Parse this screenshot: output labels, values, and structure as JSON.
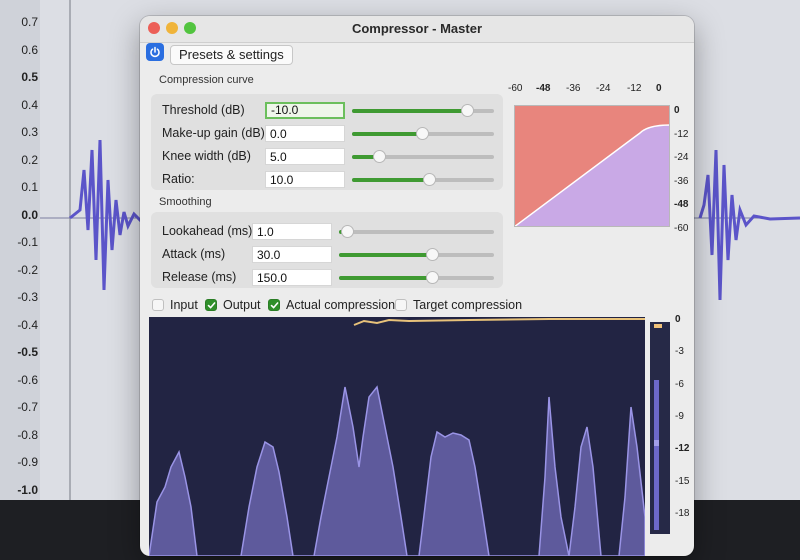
{
  "background": {
    "ruler_ticks": [
      "0.7",
      "0.6",
      "0.5",
      "0.4",
      "0.3",
      "0.2",
      "0.1",
      "0.0",
      "-0.1",
      "-0.2",
      "-0.3",
      "-0.4",
      "-0.5",
      "-0.6",
      "-0.7",
      "-0.8",
      "-0.9",
      "-1.0"
    ],
    "bold_ticks": [
      "0.5",
      "0.0",
      "-0.5",
      "-1.0"
    ]
  },
  "window": {
    "title": "Compressor - Master",
    "presets_label": "Presets & settings"
  },
  "compression_curve": {
    "section_label": "Compression curve",
    "rows": [
      {
        "label": "Threshold (dB)",
        "value": "-10.0",
        "slider": 0.81
      },
      {
        "label": "Make-up gain (dB)",
        "value": "0.0",
        "slider": 0.49
      },
      {
        "label": "Knee width (dB)",
        "value": "5.0",
        "slider": 0.19
      },
      {
        "label": "Ratio:",
        "value": "10.0",
        "slider": 0.54
      }
    ]
  },
  "smoothing": {
    "section_label": "Smoothing",
    "rows": [
      {
        "label": "Lookahead (ms)",
        "value": "1.0",
        "slider": 0.05
      },
      {
        "label": "Attack (ms)",
        "value": "30.0",
        "slider": 0.6
      },
      {
        "label": "Release (ms)",
        "value": "150.0",
        "slider": 0.6
      }
    ]
  },
  "curve_graph": {
    "top_axis": [
      "-60",
      "-48",
      "-36",
      "-24",
      "-12",
      "0"
    ],
    "right_axis": [
      "0",
      "-12",
      "-24",
      "-36",
      "-48",
      "-60"
    ],
    "bold": [
      "-48",
      "0"
    ],
    "colors": {
      "compressed": "#e8857d",
      "output": "#c9a9e6"
    }
  },
  "checkboxes": [
    {
      "label": "Input",
      "checked": false
    },
    {
      "label": "Output",
      "checked": true
    },
    {
      "label": "Actual compression",
      "checked": true
    },
    {
      "label": "Target compression",
      "checked": false
    }
  ],
  "meter_scale": [
    "0",
    "-3",
    "-6",
    "-9",
    "-12",
    "-15",
    "-18"
  ],
  "meter_bold": [
    "0",
    "-12"
  ],
  "colors": {
    "accent": "#3f9a32",
    "power": "#2a6ee0",
    "meter_bg": "#222443",
    "waveform": "#8c86d9"
  }
}
